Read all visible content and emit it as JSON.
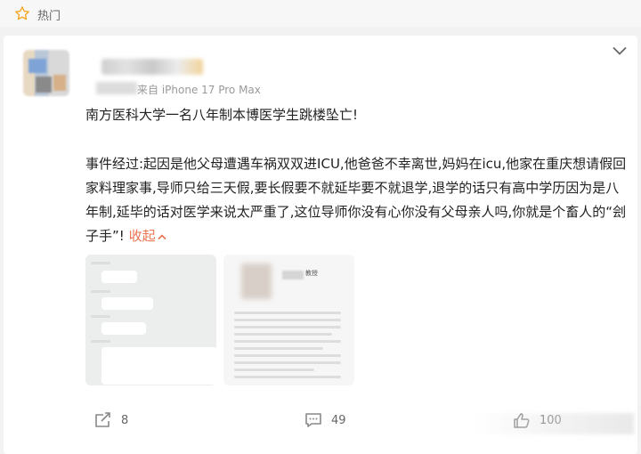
{
  "hotbar": {
    "label": "热门",
    "icon": "star-icon"
  },
  "post": {
    "device": "来自 iPhone 17 Pro Max",
    "title": "南方医科大学一名八年制本博医学生跳楼坠亡!",
    "body": "事件经过:起因是他父母遭遇车祸双双进ICU,他爸爸不幸离世,妈妈在icu,他家在重庆想请假回家料理家事,导师只给三天假,要长假要不就延毕要不就退学,退学的话只有高中学历因为是八年制,延毕的话对医学来说太严重了,这位导师你没有心你没有父母亲人吗,你就是个畜人的“刽子手”!",
    "collapse_label": "收起",
    "thumb2_label": "教授"
  },
  "footer": {
    "share_count": "8",
    "comment_count": "49",
    "like_count": "100"
  },
  "colors": {
    "accent": "#eb7350",
    "icon": "#888888"
  }
}
